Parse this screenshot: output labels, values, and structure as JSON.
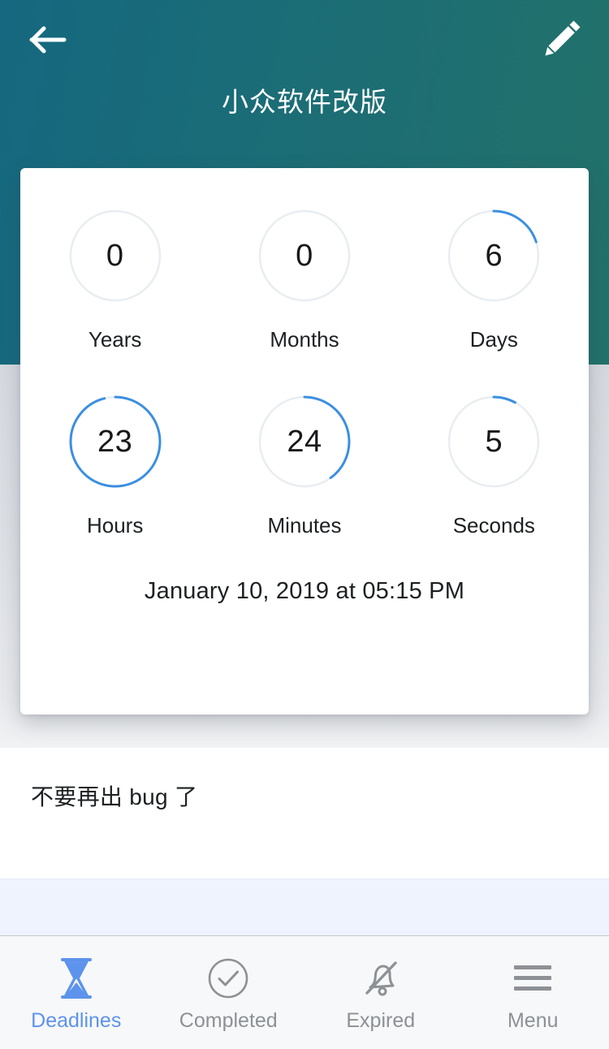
{
  "header": {
    "title": "小众软件改版",
    "back_icon": "arrow-left-icon",
    "edit_icon": "pencil-icon",
    "gradient_from": "#15687f",
    "gradient_to": "#22716a"
  },
  "card": {
    "date_text": "January 10, 2019 at 05:15 PM",
    "accent_color": "#3b8fe0",
    "track_color": "#e9edf1",
    "units": [
      {
        "label": "Years",
        "value": "0",
        "percent": 0,
        "name": "years"
      },
      {
        "label": "Months",
        "value": "0",
        "percent": 0,
        "name": "months"
      },
      {
        "label": "Days",
        "value": "6",
        "percent": 20,
        "name": "days"
      },
      {
        "label": "Hours",
        "value": "23",
        "percent": 96,
        "name": "hours"
      },
      {
        "label": "Minutes",
        "value": "24",
        "percent": 40,
        "name": "minutes"
      },
      {
        "label": "Seconds",
        "value": "5",
        "percent": 8,
        "name": "seconds"
      }
    ]
  },
  "note": {
    "text": "不要再出 bug 了"
  },
  "tabbar": {
    "active_color": "#5d93ec",
    "inactive_color": "#8d9196",
    "tabs": [
      {
        "label": "Deadlines",
        "icon": "hourglass-icon",
        "active": true
      },
      {
        "label": "Completed",
        "icon": "check-circle-icon",
        "active": false
      },
      {
        "label": "Expired",
        "icon": "bell-off-icon",
        "active": false
      },
      {
        "label": "Menu",
        "icon": "hamburger-icon",
        "active": false
      }
    ]
  }
}
